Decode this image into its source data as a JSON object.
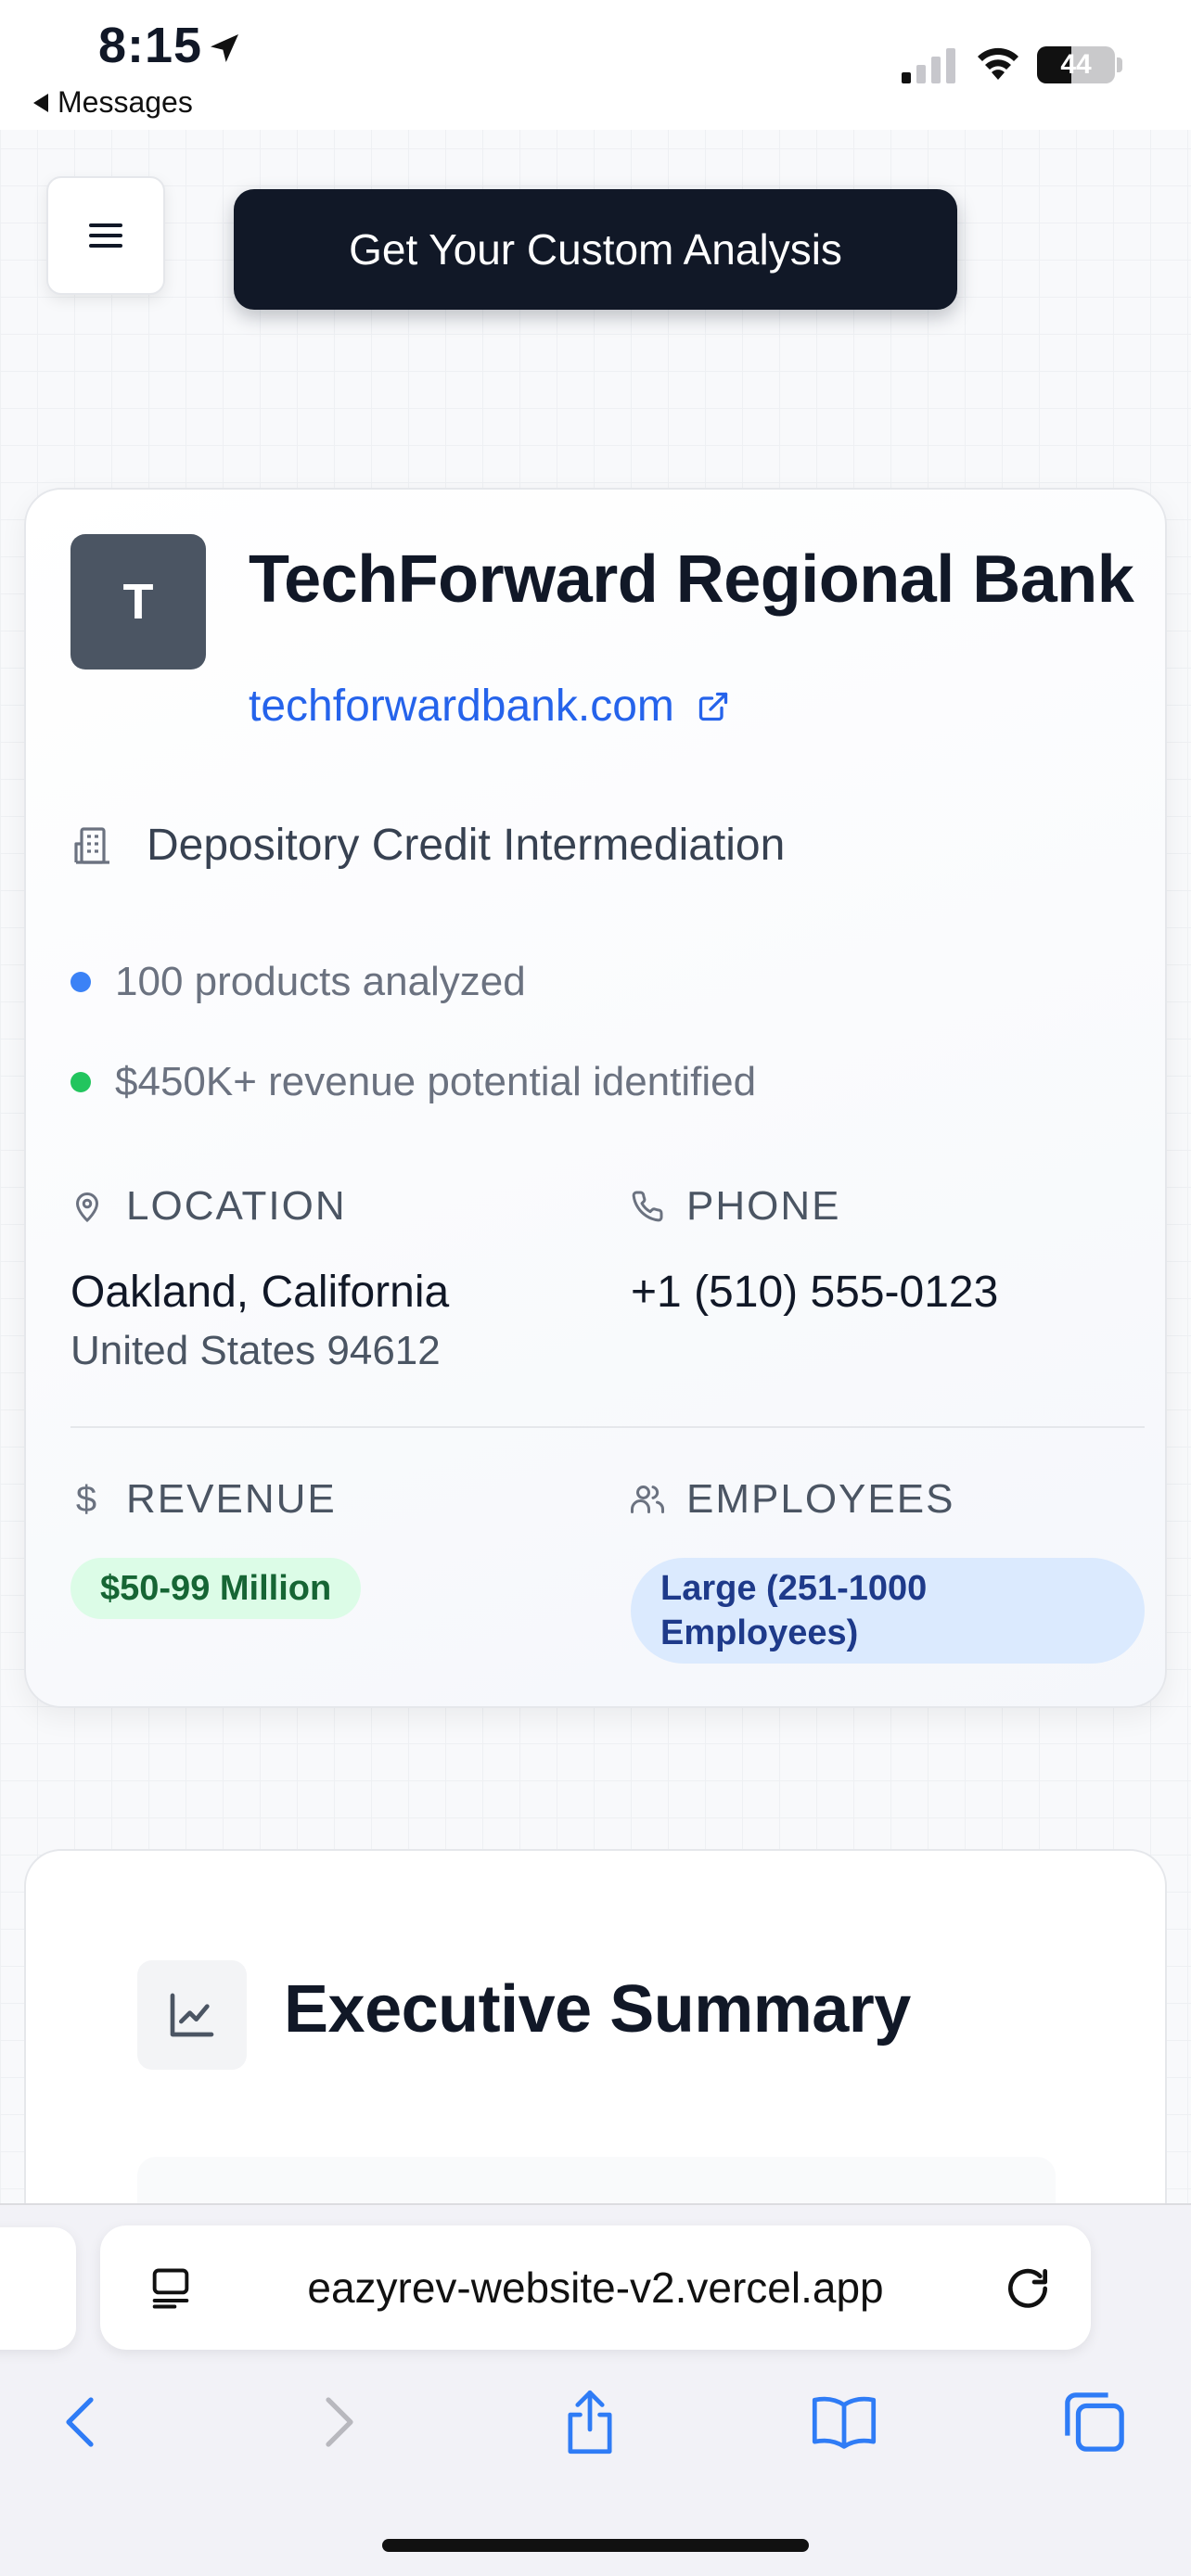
{
  "status_bar": {
    "time": "8:15",
    "back_label": "Messages",
    "battery": "44",
    "battery_level": 0.44
  },
  "header": {
    "menu_icon": "hamburger-icon",
    "cta_label": "Get Your Custom Analysis"
  },
  "company": {
    "logo_letter": "T",
    "name": "TechForward Regional Bank",
    "url": "techforwardbank.com",
    "industry": "Depository Credit Intermediation",
    "stats": [
      {
        "text": "100 products analyzed",
        "color": "#3b82f6"
      },
      {
        "text": "$450K+ revenue potential identified",
        "color": "#22c55e"
      }
    ],
    "location_label": "LOCATION",
    "location_city": "Oakland, California",
    "location_country": "United States 94612",
    "phone_label": "PHONE",
    "phone_value": "+1 (510) 555-0123",
    "revenue_label": "REVENUE",
    "revenue_value": "$50-99 Million",
    "employees_label": "EMPLOYEES",
    "employees_value": "Large (251-1000 Employees)"
  },
  "executive_summary": {
    "title": "Executive Summary",
    "icon": "line-chart-icon"
  },
  "browser": {
    "url": "eazyrev-website-v2.vercel.app"
  },
  "colors": {
    "accent_dark": "#111827",
    "link": "#2563eb",
    "badge_green_bg": "#dcfce7",
    "badge_blue_bg": "#dbeafe"
  }
}
